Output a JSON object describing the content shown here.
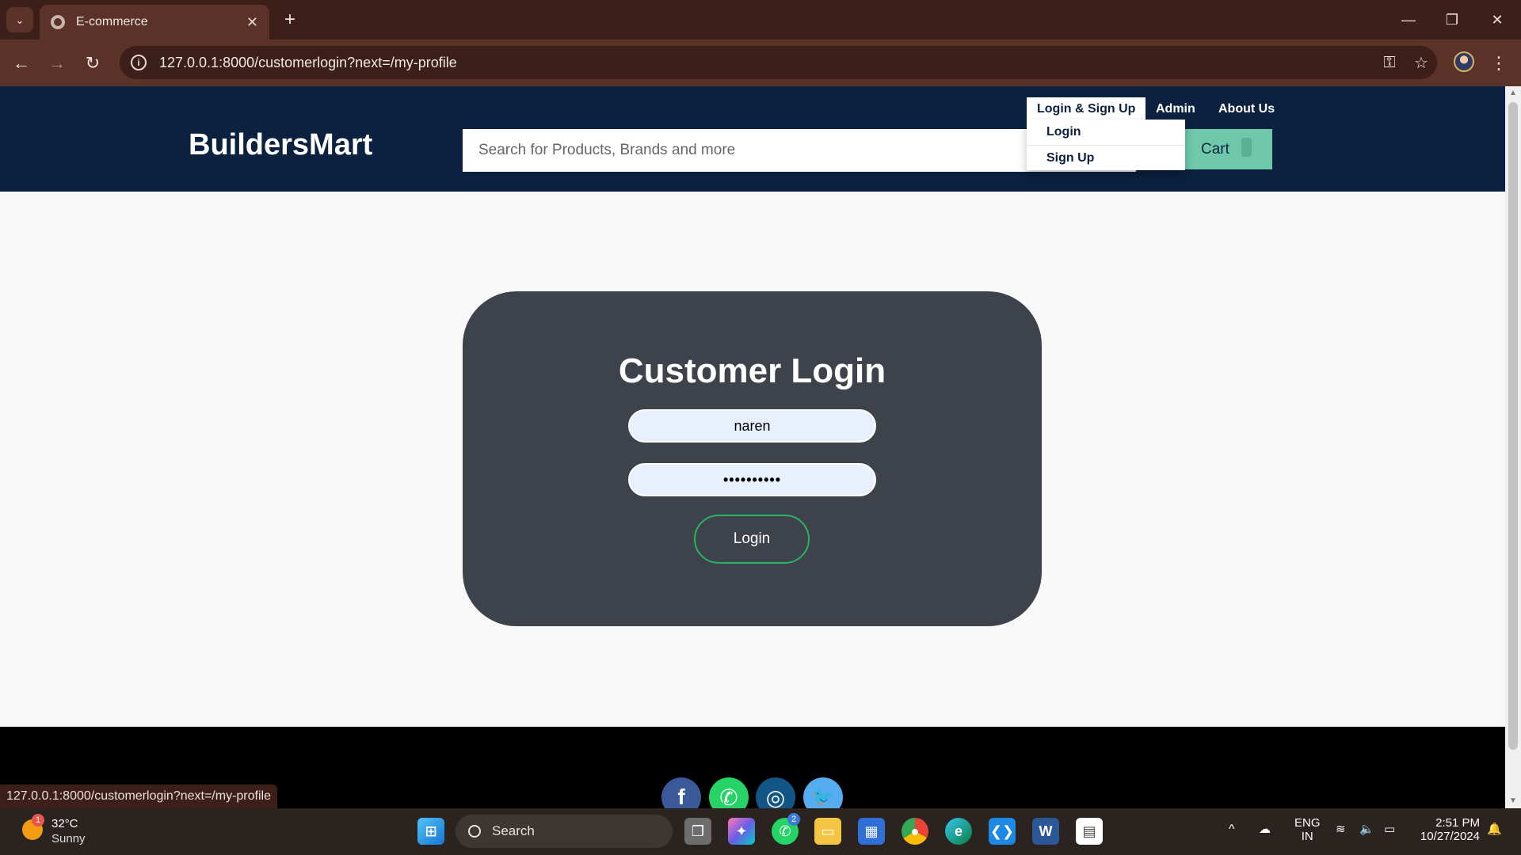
{
  "browser": {
    "tab_title": "E-commerce",
    "tab_close": "✕",
    "new_tab": "+",
    "url": "127.0.0.1:8000/customerlogin?next=/my-profile",
    "status_url": "127.0.0.1:8000/customerlogin?next=/my-profile"
  },
  "site": {
    "brand": "BuildersMart",
    "search_placeholder": "Search for Products, Brands and more",
    "cart_label": "Cart",
    "nav": {
      "login_signup": "Login & Sign Up",
      "admin": "Admin",
      "about": "About Us"
    },
    "dropdown": {
      "login": "Login",
      "signup": "Sign Up"
    }
  },
  "login_form": {
    "title": "Customer Login",
    "username_value": "naren",
    "password_value": "••••••••••",
    "submit_label": "Login"
  },
  "social": [
    {
      "name": "facebook",
      "glyph": "f",
      "color": "#3b5998"
    },
    {
      "name": "whatsapp",
      "glyph": "✆",
      "color": "#25d366"
    },
    {
      "name": "instagram",
      "glyph": "◎",
      "color": "#125688"
    },
    {
      "name": "twitter",
      "glyph": "🐦",
      "color": "#55acee"
    }
  ],
  "taskbar": {
    "weather_badge": "1",
    "weather_temp": "32°C",
    "weather_desc": "Sunny",
    "search_label": "Search",
    "whatsapp_badge": "2",
    "lang_line1": "ENG",
    "lang_line2": "IN",
    "time": "2:51 PM",
    "date": "10/27/2024"
  },
  "colors": {
    "header_bg": "#0b213f",
    "card_bg": "#3e434b",
    "cart_bg": "#6fc8a9",
    "login_border": "#28b463",
    "chrome_dark": "#3b1f18",
    "chrome_light": "#5a3228"
  }
}
